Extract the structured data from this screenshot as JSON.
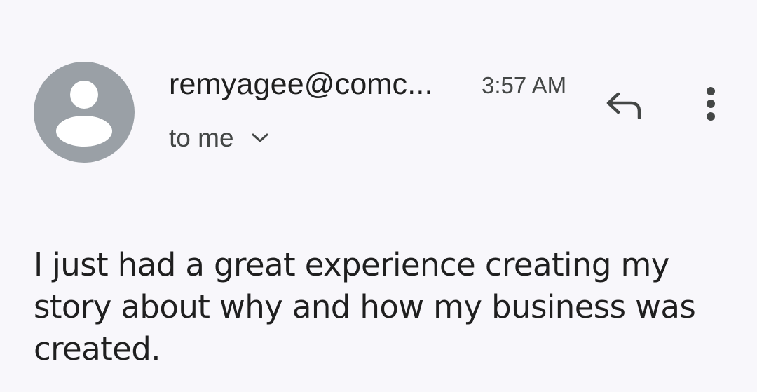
{
  "message": {
    "sender": "remyagee@comc...",
    "time": "3:57 AM",
    "recipient_label": "to me",
    "body": "I just had a great experience creating my story about why and how my business was created."
  },
  "icons": {
    "avatar": "default-person-avatar",
    "expand": "chevron-down-icon",
    "reply": "reply-icon",
    "more": "more-vert-icon"
  },
  "colors": {
    "background": "#f8f7fb",
    "avatar_bg": "#9aa0a6",
    "text_primary": "#1f1f1f",
    "text_secondary": "#444746"
  }
}
